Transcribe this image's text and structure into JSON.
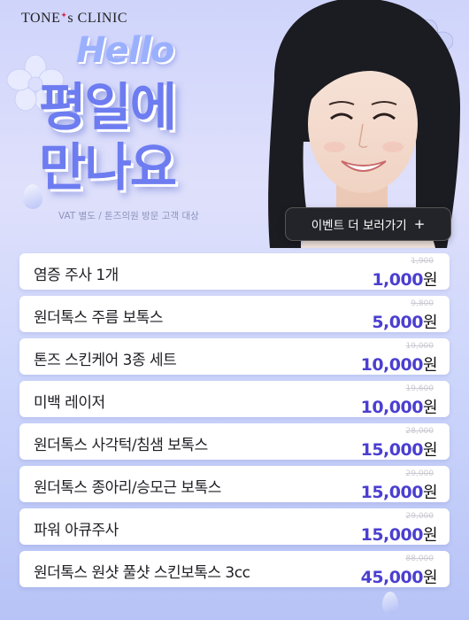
{
  "brand": {
    "logo_main": "TONE",
    "logo_s": "s",
    "logo_tail": "CLINIC"
  },
  "hero": {
    "hello": "Hello",
    "headline_line1": "평일에",
    "headline_line2": "만나요",
    "note": "VAT 별도 / 톤즈의원 방문 고객 대상"
  },
  "event_button": {
    "label": "이벤트 더 보러가기",
    "icon": "plus-icon",
    "plus": "+"
  },
  "colors": {
    "accent": "#4b3fd0",
    "headline": "#6d7cf0",
    "button_bg": "#232429"
  },
  "items": [
    {
      "name": "염증 주사 1개",
      "old_price": "1,900",
      "price": "1,000",
      "unit": "원"
    },
    {
      "name": "원더톡스 주름 보톡스",
      "old_price": "9,800",
      "price": "5,000",
      "unit": "원"
    },
    {
      "name": "톤즈 스킨케어 3종 세트",
      "old_price": "19,000",
      "price": "10,000",
      "unit": "원"
    },
    {
      "name": "미백 레이저",
      "old_price": "19,600",
      "price": "10,000",
      "unit": "원"
    },
    {
      "name": "원더톡스 사각턱/침샘 보톡스",
      "old_price": "28,000",
      "price": "15,000",
      "unit": "원"
    },
    {
      "name": "원더톡스 종아리/승모근 보톡스",
      "old_price": "29,000",
      "price": "15,000",
      "unit": "원"
    },
    {
      "name": "파워 아큐주사",
      "old_price": "29,000",
      "price": "15,000",
      "unit": "원"
    },
    {
      "name": "원더톡스 원샷 풀샷 스킨보톡스 3cc",
      "old_price": "88,000",
      "price": "45,000",
      "unit": "원"
    }
  ]
}
